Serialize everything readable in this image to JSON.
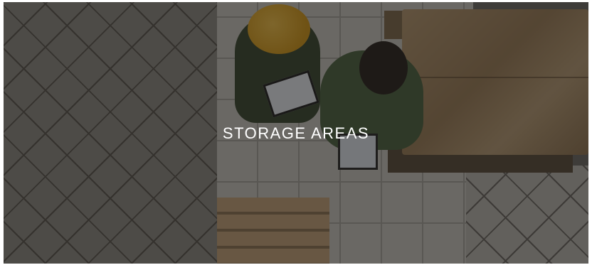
{
  "banner": {
    "title": "STORAGE AREAS"
  }
}
